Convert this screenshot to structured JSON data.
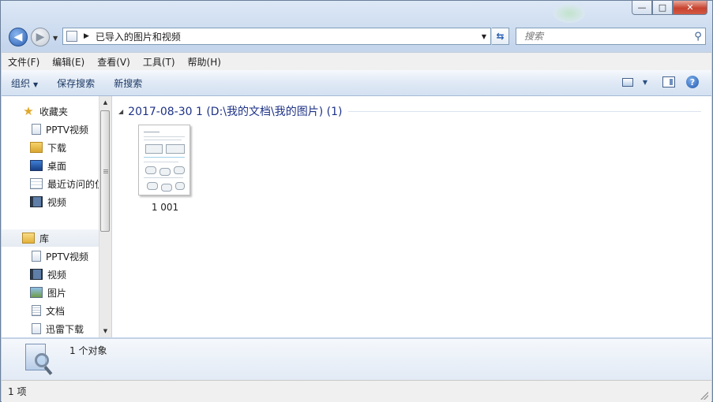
{
  "window": {
    "caption_minimize": "—",
    "caption_maximize": "□",
    "caption_close": "✕"
  },
  "address": {
    "path": "已导入的图片和视频",
    "separator_glyph": "▶",
    "dropdown_glyph": "▼",
    "refresh_glyph": "⇆"
  },
  "search": {
    "placeholder": "搜索",
    "icon": "magnifier-icon"
  },
  "menubar": {
    "items": [
      "文件(F)",
      "编辑(E)",
      "查看(V)",
      "工具(T)",
      "帮助(H)"
    ]
  },
  "commandbar": {
    "organize": "组织",
    "save_search": "保存搜索",
    "new_search": "新搜索",
    "icons": [
      "view-icon",
      "preview-pane-icon",
      "help-icon"
    ],
    "help_glyph": "?"
  },
  "navpane": {
    "favorites_header": "收藏夹",
    "favorites": [
      {
        "label": "PPTV视频",
        "icon": "document-icon"
      },
      {
        "label": "下载",
        "icon": "download-folder-icon"
      },
      {
        "label": "桌面",
        "icon": "desktop-icon"
      },
      {
        "label": "最近访问的位置",
        "icon": "recent-places-icon"
      },
      {
        "label": "视频",
        "icon": "video-folder-icon"
      }
    ],
    "libraries_header": "库",
    "libraries": [
      {
        "label": "PPTV视频",
        "icon": "document-icon"
      },
      {
        "label": "视频",
        "icon": "video-library-icon"
      },
      {
        "label": "图片",
        "icon": "pictures-library-icon"
      },
      {
        "label": "文档",
        "icon": "documents-library-icon"
      },
      {
        "label": "迅雷下载",
        "icon": "document-icon"
      }
    ]
  },
  "content": {
    "group_header": "2017-08-30 1 (D:\\我的文档\\我的图片) (1)",
    "items": [
      {
        "name": "1 001",
        "icon": "image-thumbnail"
      }
    ]
  },
  "details": {
    "summary": "1 个对象"
  },
  "statusbar": {
    "text": "1 项"
  }
}
